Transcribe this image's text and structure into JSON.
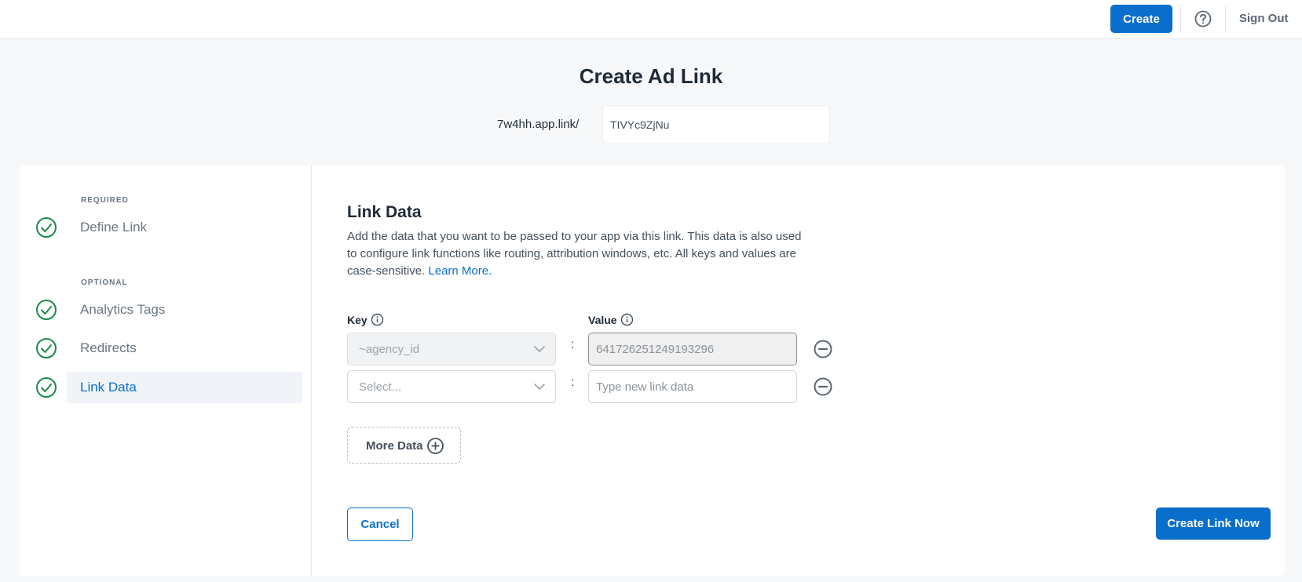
{
  "header": {
    "create_label": "Create",
    "help_icon": "question-circle-icon",
    "signout_label": "Sign Out",
    "accent_color": "#0a6fcc"
  },
  "page": {
    "title": "Create Ad Link",
    "domain": "7w4hh.app.link/",
    "alias_value": "TIVYc9ZjNu"
  },
  "sidebar": {
    "required_label": "REQUIRED",
    "optional_label": "OPTIONAL",
    "items": [
      {
        "label": "Define Link",
        "completed": true,
        "active": false
      },
      {
        "label": "Analytics Tags",
        "completed": true,
        "active": false
      },
      {
        "label": "Redirects",
        "completed": true,
        "active": false
      },
      {
        "label": "Link Data",
        "completed": true,
        "active": true
      }
    ],
    "check_color": "#1a8a4a"
  },
  "link_data": {
    "title": "Link Data",
    "description": "Add the data that you want to be passed to your app via this link. This data is also used to configure link functions like routing, attribution windows, etc. All keys and values are case-sensitive.",
    "learn_more": "Learn More.",
    "key_label": "Key",
    "value_label": "Value",
    "rows": [
      {
        "key": "~agency_id",
        "value": "641726251249193296",
        "disabled": true
      },
      {
        "key": "Select...",
        "value": "",
        "value_placeholder": "Type new link data",
        "disabled": false
      }
    ],
    "more_data_label": "More Data",
    "cancel_label": "Cancel",
    "create_now_label": "Create Link Now"
  }
}
